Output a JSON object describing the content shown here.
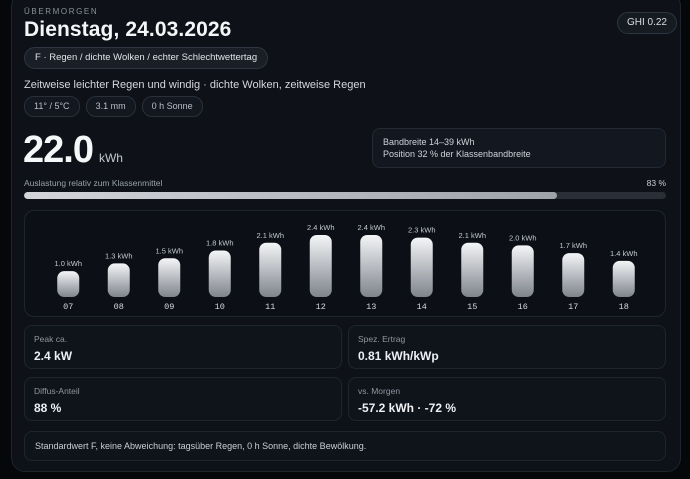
{
  "header": {
    "eyebrow": "ÜBERMORGEN",
    "title": "Dienstag, 24.03.2026",
    "ghi": "GHI 0.22"
  },
  "condition": {
    "label": "F · Regen / dichte Wolken / echter Schlechtwettertag",
    "description": "Zeitweise leichter Regen und windig · dichte Wolken, zeitweise Regen",
    "chips": [
      "11° / 5°C",
      "3.1 mm",
      "0 h Sonne"
    ]
  },
  "energy": {
    "value": "22.0",
    "unit": "kWh"
  },
  "range": {
    "line1": "Bandbreite 14–39 kWh",
    "line2": "Position 32 % der Klassenbandbreite"
  },
  "utilization": {
    "label": "Auslastung relativ zum Klassenmittel",
    "percent_label": "83 %",
    "fraction": 0.83
  },
  "chart_data": {
    "type": "bar",
    "categories": [
      "07",
      "08",
      "09",
      "10",
      "11",
      "12",
      "13",
      "14",
      "15",
      "16",
      "17",
      "18"
    ],
    "values": [
      1.0,
      1.3,
      1.5,
      1.8,
      2.1,
      2.4,
      2.4,
      2.3,
      2.1,
      2.0,
      1.7,
      1.4
    ],
    "value_labels": [
      "1.0 kWh",
      "1.3 kWh",
      "1.5 kWh",
      "1.8 kWh",
      "2.1 kWh",
      "2.4 kWh",
      "2.4 kWh",
      "2.3 kWh",
      "2.1 kWh",
      "2.0 kWh",
      "1.7 kWh",
      "1.4 kWh"
    ],
    "ylim": [
      0,
      2.4
    ]
  },
  "stats": {
    "peak": {
      "label": "Peak ca.",
      "value": "2.4 kW"
    },
    "specific": {
      "label": "Spez. Ertrag",
      "value": "0.81 kWh/kWp"
    },
    "diffuse": {
      "label": "Diffus-Anteil",
      "value": "88 %"
    },
    "vs_tomorrow": {
      "label": "vs. Morgen",
      "value": "-57.2 kWh · -72 %"
    }
  },
  "note": "Standardwert F, keine Abweichung: tagsüber Regen, 0 h Sonne, dichte Bewölkung."
}
